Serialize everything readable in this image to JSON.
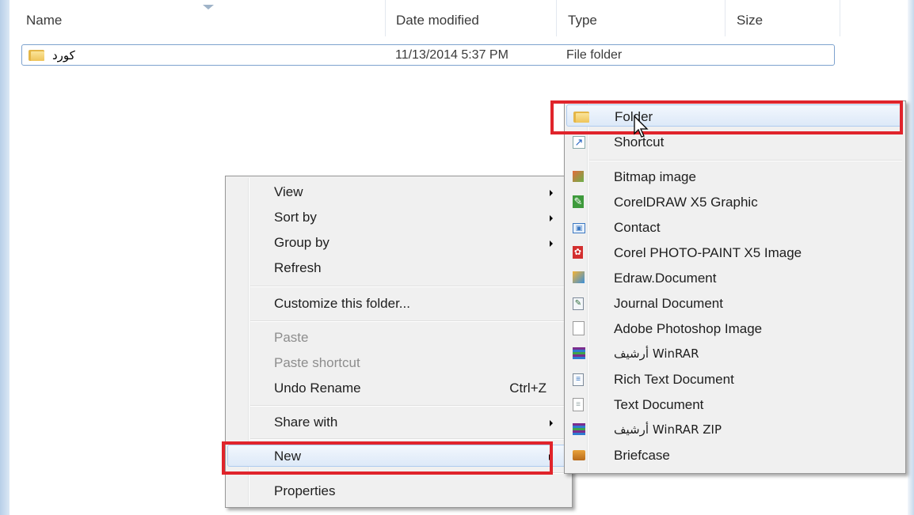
{
  "columns": {
    "name": "Name",
    "date_modified": "Date modified",
    "type": "Type",
    "size": "Size"
  },
  "file": {
    "name": "کورد",
    "date_modified": "11/13/2014 5:37 PM",
    "type": "File folder"
  },
  "context_menu": {
    "view": "View",
    "sort_by": "Sort by",
    "group_by": "Group by",
    "refresh": "Refresh",
    "customize": "Customize this folder...",
    "paste": "Paste",
    "paste_shortcut": "Paste shortcut",
    "undo_rename": "Undo Rename",
    "undo_shortcut": "Ctrl+Z",
    "share_with": "Share with",
    "new": "New",
    "properties": "Properties"
  },
  "new_submenu": {
    "folder": "Folder",
    "shortcut": "Shortcut",
    "bitmap": "Bitmap image",
    "coreldraw": "CorelDRAW X5 Graphic",
    "contact": "Contact",
    "corel_photopaint": "Corel PHOTO-PAINT X5 Image",
    "edraw": "Edraw.Document",
    "journal": "Journal Document",
    "photoshop": "Adobe Photoshop Image",
    "winrar": "أرشيف WinRAR",
    "rtf": "Rich Text Document",
    "text": "Text Document",
    "winrar_zip": "أرشيف WinRAR ZIP",
    "briefcase": "Briefcase"
  },
  "colors": {
    "highlight_box": "#e0242b",
    "selection_border": "#7da2ce"
  }
}
